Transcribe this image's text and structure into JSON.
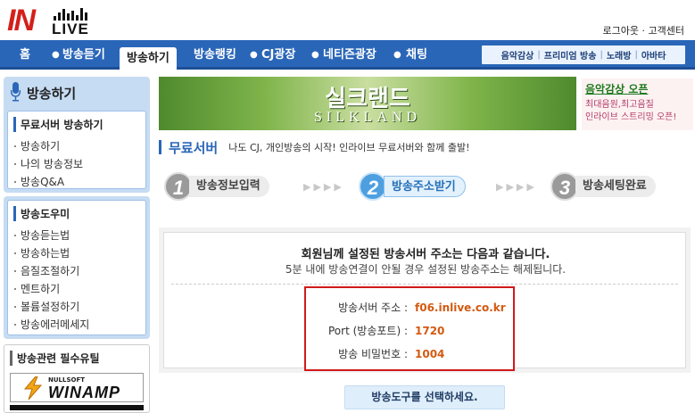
{
  "header": {
    "logo_in": "IN",
    "logo_live": "LIVE",
    "logout": "로그아웃",
    "separator": "·",
    "support": "고객센터"
  },
  "nav": {
    "items": [
      "홈",
      "방송듣기",
      "방송하기",
      "방송랭킹",
      "CJ광장",
      "네티즌광장",
      "채팅"
    ],
    "active": "방송하기",
    "sub_items": [
      "음악감상",
      "프리미엄 방송",
      "노래방",
      "아바타"
    ]
  },
  "sidebar": {
    "title": "방송하기",
    "section1": {
      "heading": "무료서버 방송하기",
      "items": [
        "방송하기",
        "나의 방송정보",
        "방송Q&A"
      ]
    },
    "section2": {
      "heading": "방송도우미",
      "items": [
        "방송듣는법",
        "방송하는법",
        "음질조절하기",
        "멘트하기",
        "볼륨설정하기",
        "방송에러메세지"
      ]
    },
    "section3": {
      "heading": "방송관련 필수유틸",
      "winamp_top": "NULLSOFT",
      "winamp_name": "WINAMP"
    }
  },
  "banner": {
    "title_ko": "실크랜드",
    "title_en": "SILKLAND"
  },
  "promo": {
    "title": "음악감상 오픈",
    "line1": "최대음원,최고음질",
    "line2": "인라이브 스트리밍 오픈!"
  },
  "section": {
    "title": "무료서버",
    "subtitle": "나도 CJ, 개인방송의 시작! 인라이브 무료서버와 함께 출발!"
  },
  "steps": [
    {
      "num": "1",
      "label": "방송정보입력"
    },
    {
      "num": "2",
      "label": "방송주소받기"
    },
    {
      "num": "3",
      "label": "방송세팅완료"
    }
  ],
  "step_arrows": "▶▶▶▶",
  "main": {
    "message1": "회원님께 설정된 방송서버 주소는 다음과 같습니다.",
    "message2": "5분 내에 방송연결이 안될 경우 설정된 방송주소는 해제됩니다.",
    "server_label": "방송서버 주소 :",
    "server_value": "f06.inlive.co.kr",
    "port_label": "Port (방송포트) :",
    "port_value": "1720",
    "password_label": "방송 비밀번호 :",
    "password_value": "1004"
  },
  "button": {
    "select_tool": "방송도구를 선택하세요."
  },
  "colors": {
    "nav_blue": "#2a66b8",
    "highlight_red": "#d11a1a",
    "value_orange": "#d35a12",
    "logo_red": "#d3201a"
  }
}
